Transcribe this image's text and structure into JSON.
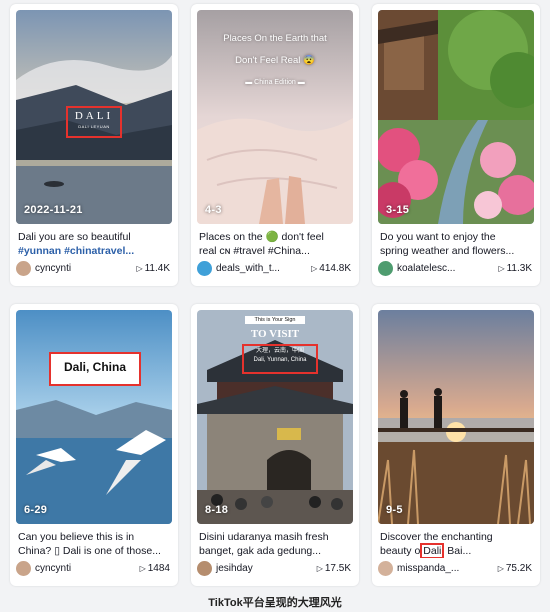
{
  "cards": [
    {
      "date": "2022-11-21",
      "overlay": "DALI",
      "overlay_sub": "DALI LEYUAN",
      "caption": "Dali you are so beautiful",
      "tags": "#yunnan #chinatravel...",
      "user": "cyncynti",
      "views": "11.4K",
      "avatar_color": "#c9a48a"
    },
    {
      "date": "4-3",
      "title_line1": "Places On the Earth that",
      "title_line2": "Don't Feel Real 😨",
      "title_line3": "▬ China Edition ▬",
      "caption": "Places on the 🟢 don't feel",
      "caption_line2": "real ᴄɴ #travel #China...",
      "user": "deals_with_t...",
      "views": "414.8K",
      "avatar_color": "#3fa0d8"
    },
    {
      "date": "3-15",
      "caption": "Do you want to enjoy the",
      "caption_line2": "spring weather and flowers...",
      "user": "koalatelesc...",
      "views": "11.3K",
      "avatar_color": "#4e9c6f"
    },
    {
      "date": "6-29",
      "overlay": "Dali, China",
      "caption": "Can you believe this is in",
      "caption_line2": "China? ▯ Dali is one of those...",
      "user": "cyncynti",
      "views": "1484",
      "avatar_color": "#c9a48a"
    },
    {
      "date": "8-18",
      "top_label": "This is Your Sign",
      "title": "TO VISIT",
      "overlay_line1": "大理，云南，中国",
      "overlay_line2": "Dali, Yunnan, China",
      "caption": "Disini udaranya masih fresh",
      "caption_line2": "banget, gak ada gedung...",
      "user": "jesihday",
      "views": "17.5K",
      "avatar_color": "#b58d6e"
    },
    {
      "date": "9-5",
      "caption": "Discover the enchanting",
      "caption_pre": "beauty o",
      "caption_word": "Dali",
      "caption_post": " Bai...",
      "user": "misspanda_...",
      "views": "75.2K",
      "avatar_color": "#d3b19a"
    }
  ],
  "footer": "TikTok平台呈现的大理风光"
}
